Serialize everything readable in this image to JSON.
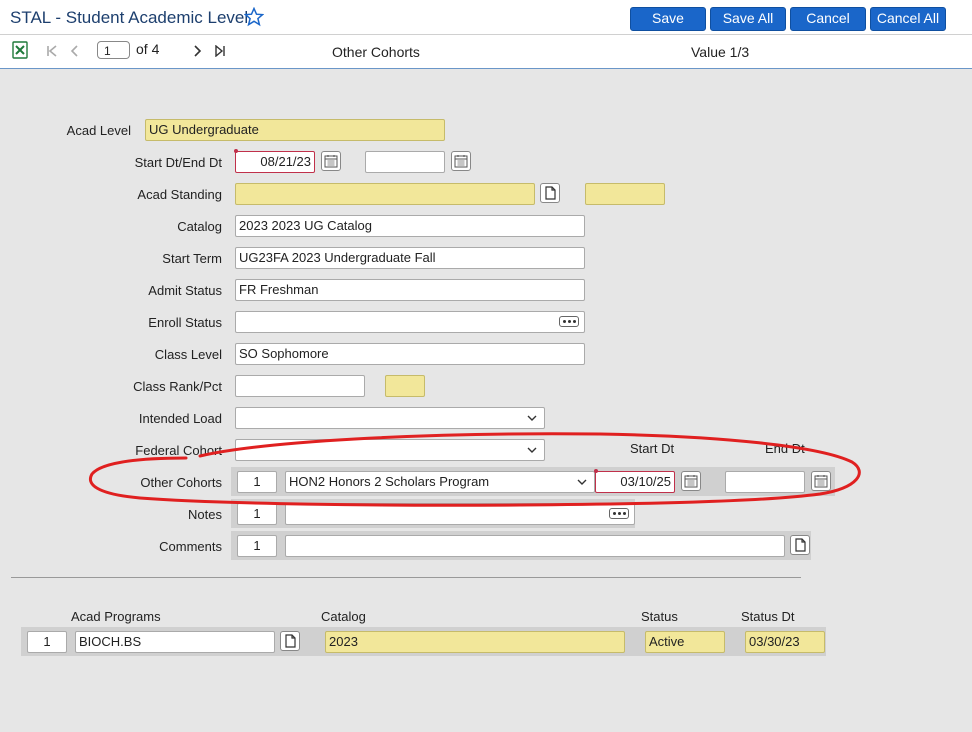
{
  "header": {
    "title": "STAL - Student Academic Level",
    "buttons": {
      "save": "Save",
      "save_all": "Save All",
      "cancel": "Cancel",
      "cancel_all": "Cancel All"
    }
  },
  "toolbar": {
    "page": "1",
    "of_label": "of 4",
    "section": "Other Cohorts",
    "value_label": "Value 1/3"
  },
  "form": {
    "acad_level": {
      "label": "Acad Level",
      "value": "UG Undergraduate"
    },
    "start_end": {
      "label": "Start Dt/End Dt",
      "start": "08/21/23",
      "end": ""
    },
    "acad_standing": {
      "label": "Acad Standing",
      "value": "",
      "extra": ""
    },
    "catalog": {
      "label": "Catalog",
      "value": "2023 2023 UG Catalog"
    },
    "start_term": {
      "label": "Start Term",
      "value": "UG23FA 2023 Undergraduate Fall"
    },
    "admit_status": {
      "label": "Admit Status",
      "value": "FR Freshman"
    },
    "enroll_status": {
      "label": "Enroll Status",
      "value": ""
    },
    "class_level": {
      "label": "Class Level",
      "value": "SO Sophomore"
    },
    "class_rank": {
      "label": "Class Rank/Pct",
      "rank": "",
      "pct": ""
    },
    "intended_load": {
      "label": "Intended Load",
      "value": ""
    },
    "federal_cohort": {
      "label": "Federal Cohort",
      "value": ""
    },
    "cohort_headers": {
      "start": "Start Dt",
      "end": "End Dt"
    },
    "other_cohorts": {
      "label": "Other Cohorts",
      "index": "1",
      "value": "HON2 Honors 2 Scholars Program",
      "start": "03/10/25",
      "end": ""
    },
    "notes": {
      "label": "Notes",
      "index": "1",
      "value": ""
    },
    "comments": {
      "label": "Comments",
      "index": "1",
      "value": ""
    }
  },
  "programs": {
    "headers": {
      "acad_programs": "Acad Programs",
      "catalog": "Catalog",
      "status": "Status",
      "status_dt": "Status Dt"
    },
    "rows": [
      {
        "index": "1",
        "program": "BIOCH.BS",
        "catalog": "2023",
        "status": "Active",
        "status_dt": "03/30/23"
      }
    ]
  },
  "colors": {
    "accent": "#1a66c9",
    "highlight": "#f2e79a",
    "annotation": "#e02020"
  }
}
